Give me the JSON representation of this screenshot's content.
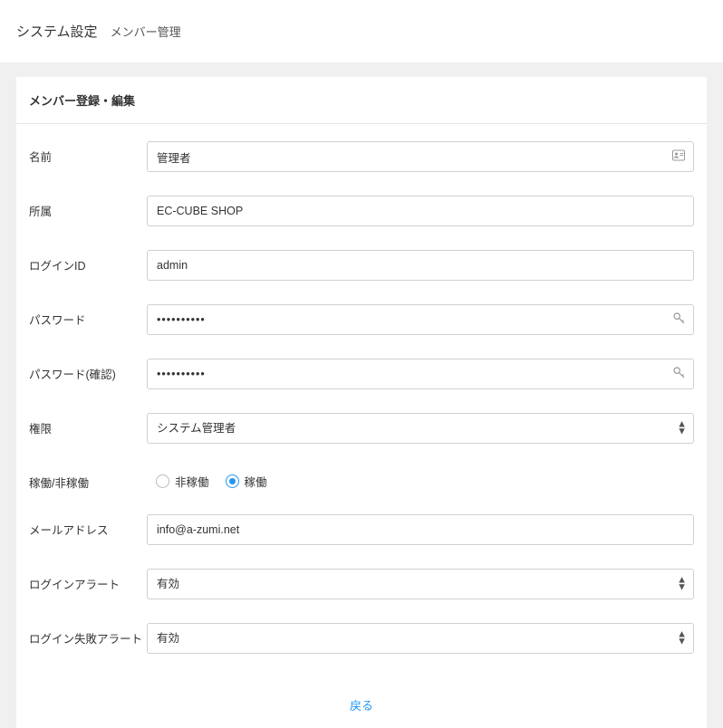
{
  "header": {
    "title": "システム設定",
    "subtitle": "メンバー管理"
  },
  "card": {
    "title": "メンバー登録・編集"
  },
  "form": {
    "name": {
      "label": "名前",
      "value": "管理者"
    },
    "affiliation": {
      "label": "所属",
      "value": "EC-CUBE SHOP"
    },
    "login_id": {
      "label": "ログインID",
      "value": "admin"
    },
    "password": {
      "label": "パスワード",
      "value": "••••••••••"
    },
    "password_confirm": {
      "label": "パスワード(確認)",
      "value": "••••••••••"
    },
    "authority": {
      "label": "権限",
      "value": "システム管理者"
    },
    "work_status": {
      "label": "稼働/非稼働",
      "options": {
        "inactive": "非稼働",
        "active": "稼働"
      },
      "selected": "active"
    },
    "email": {
      "label": "メールアドレス",
      "value": "info@a-zumi.net"
    },
    "login_alert": {
      "label": "ログインアラート",
      "value": "有効"
    },
    "login_fail_alert": {
      "label": "ログイン失敗アラート",
      "value": "有効"
    }
  },
  "footer": {
    "back": "戻る"
  }
}
